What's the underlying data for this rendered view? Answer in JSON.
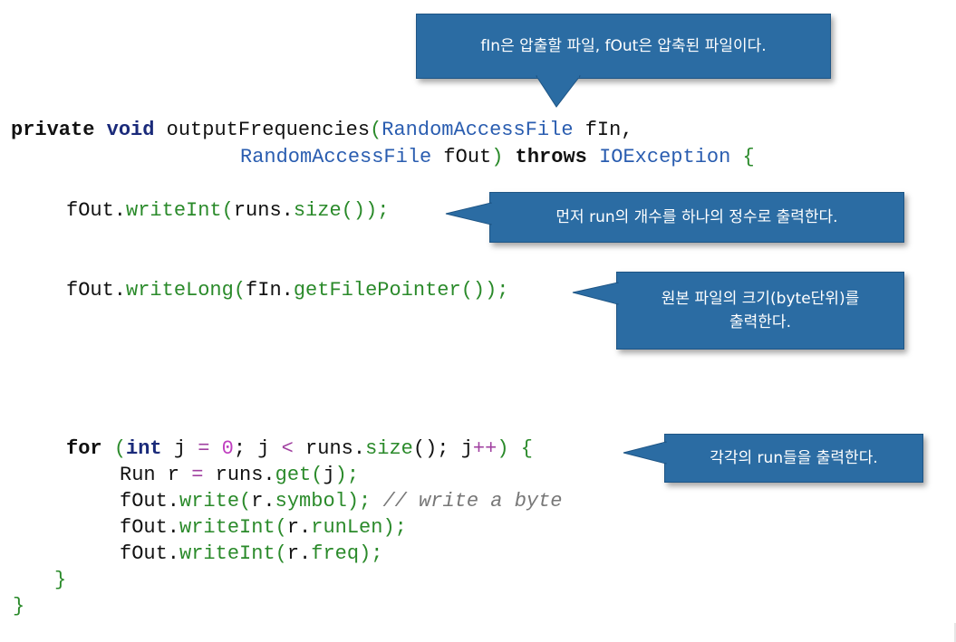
{
  "callouts": {
    "top": "fIn은 압출할 파일, fOut은 압축된 파일이다.",
    "write_int": "먼저 run의 개수를 하나의 정수로 출력한다.",
    "write_long_line1": "원본 파일의 크기(byte단위)를",
    "write_long_line2": "출력한다.",
    "loop": "각각의 run들을 출력한다."
  },
  "code": {
    "l1_private": "private",
    "l1_void": "void",
    "l1_name": " outputFrequencies",
    "l1_paren": "(",
    "l1_type": "RandomAccessFile",
    "l1_param": " fIn,",
    "l2_type": "RandomAccessFile",
    "l2_param": " fOut",
    "l2_close": ")",
    "l2_throws": "throws",
    "l2_exc": "IOException",
    "l2_brace": "{",
    "l3_obj": "fOut.",
    "l3_fn": "writeInt",
    "l3_open": "(",
    "l3_arg": "runs.",
    "l3_size": "size",
    "l3_end": "());",
    "l4_obj": "fOut.",
    "l4_fn": "writeLong",
    "l4_open": "(",
    "l4_arg": "fIn.",
    "l4_get": "getFilePointer",
    "l4_end": "());",
    "l5_for": "for",
    "l5_open": "(",
    "l5_int": "int",
    "l5_j": " j ",
    "l5_eq": "=",
    "l5_zero": "0",
    "l5_mid": "; j ",
    "l5_lt": "<",
    "l5_runs": " runs.",
    "l5_size": "size",
    "l5_tail": "(); j",
    "l5_pp": "++",
    "l5_close": ")",
    "l5_brace": "{",
    "l6_a": "Run r ",
    "l6_eq": "=",
    "l6_b": " runs.",
    "l6_get": "get",
    "l6_open": "(",
    "l6_j": "j",
    "l6_end": ");",
    "l7_obj": "fOut.",
    "l7_fn": "write",
    "l7_open": "(",
    "l7_arg": "r.",
    "l7_sym": "symbol",
    "l7_end": ");",
    "l7_comment": "// write a byte",
    "l8_obj": "fOut.",
    "l8_fn": "writeInt",
    "l8_open": "(",
    "l8_arg": "r.",
    "l8_field": "runLen",
    "l8_end": ");",
    "l9_obj": "fOut.",
    "l9_fn": "writeInt",
    "l9_open": "(",
    "l9_arg": "r.",
    "l9_field": "freq",
    "l9_end": ");",
    "l10_brace": "}",
    "l11_brace": "}"
  },
  "colors": {
    "callout_bg": "#2b6ca3",
    "keyword": "#111111",
    "type": "#2a5db0",
    "method": "#2a8a2a",
    "number": "#c040c0",
    "comment": "#777777"
  }
}
